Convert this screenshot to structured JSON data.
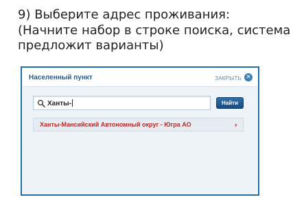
{
  "instruction": {
    "line1": "9) Выберите адрес проживания:",
    "line2": "(Начните набор в строке поиска, система",
    "line3": "предложит варианты)"
  },
  "dialog": {
    "title": "Населенный пункт",
    "close_label": "ЗАКРЫТЬ",
    "close_icon": "close-icon",
    "search": {
      "value": "Ханты-",
      "icon": "search-icon"
    },
    "find_button_label": "Найти",
    "suggestions": [
      {
        "label": "Ханты-Мансийский Автономный округ - Югра АО",
        "icon": "chevron-right-icon"
      }
    ]
  },
  "colors": {
    "frame_border": "#1d6ea6",
    "title": "#1e5f93",
    "button": "#174b82",
    "suggestion_text": "#b32b2b",
    "dialog_background": "#eef3f7"
  }
}
